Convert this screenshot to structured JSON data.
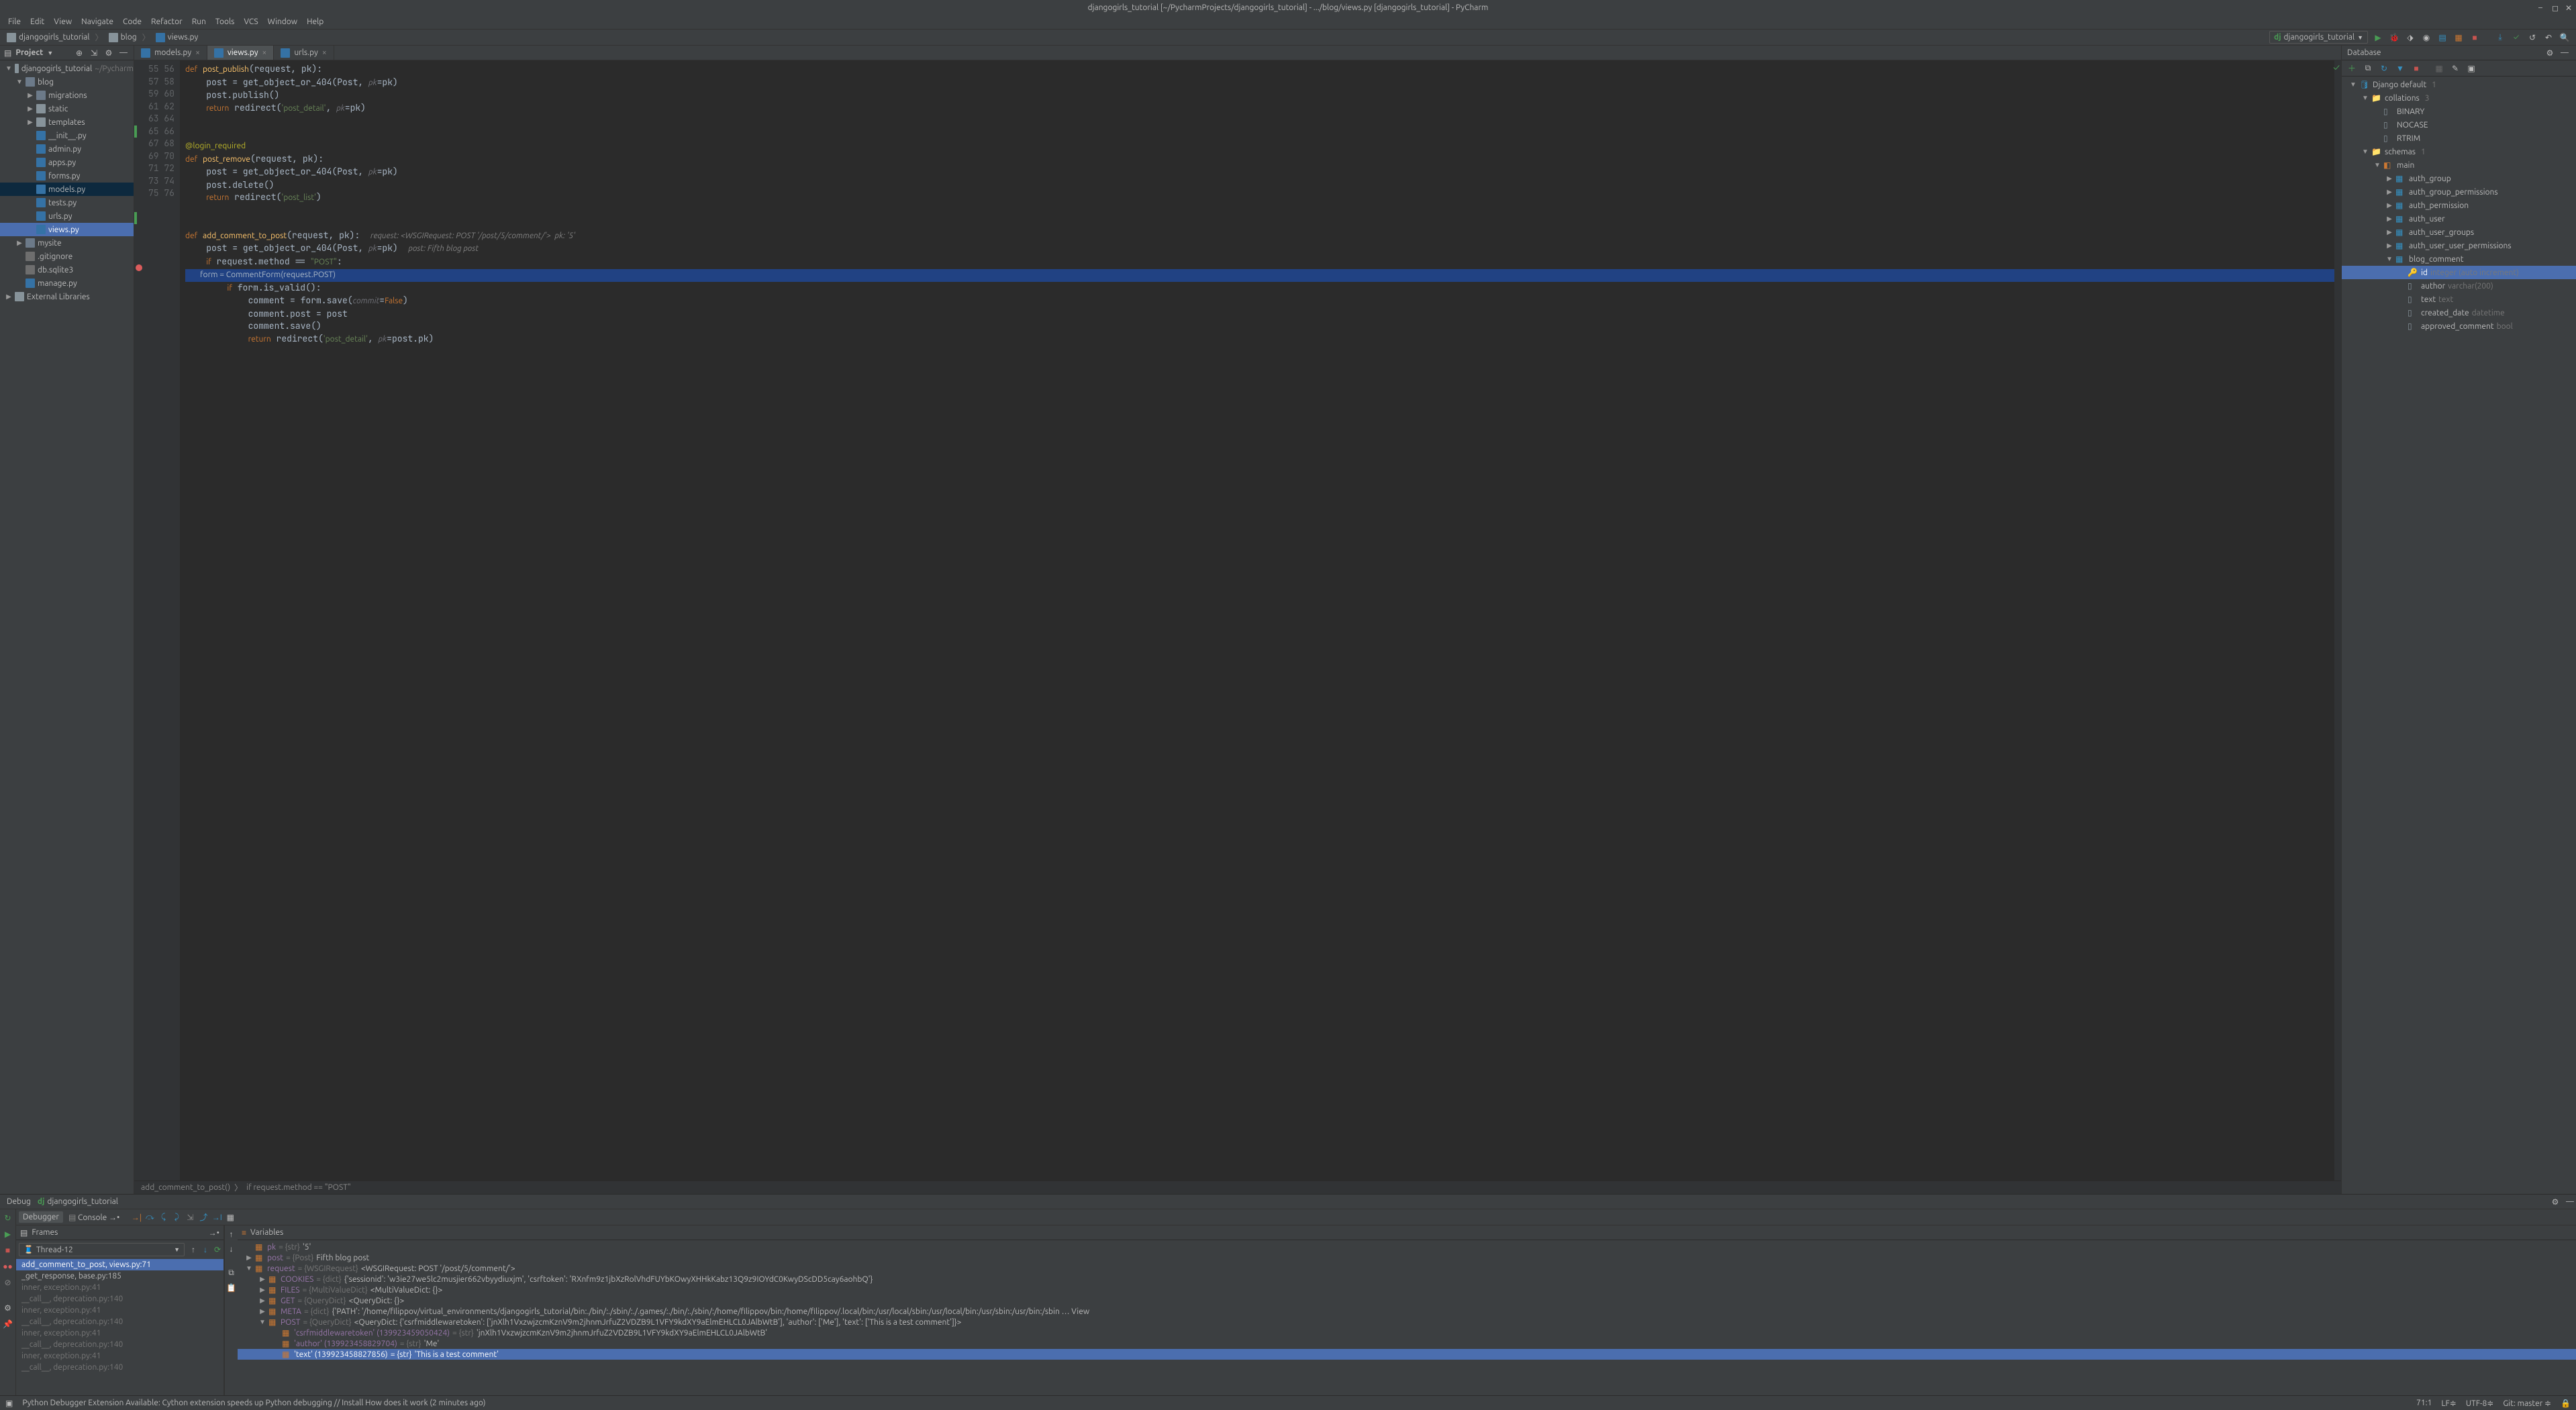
{
  "title": "djangogirls_tutorial [~/PycharmProjects/djangogirls_tutorial] - .../blog/views.py [djangogirls_tutorial] - PyCharm",
  "menu": [
    "File",
    "Edit",
    "View",
    "Navigate",
    "Code",
    "Refactor",
    "Run",
    "Tools",
    "VCS",
    "Window",
    "Help"
  ],
  "nav": {
    "crumbs": [
      {
        "icon": "folder",
        "label": "djangogirls_tutorial"
      },
      {
        "icon": "folder",
        "label": "blog"
      },
      {
        "icon": "py",
        "label": "views.py"
      }
    ],
    "run_config": "djangogirls_tutorial"
  },
  "project": {
    "title": "Project",
    "tree": [
      {
        "d": 0,
        "a": "▼",
        "i": "folder",
        "t": "djangogirls_tutorial",
        "hint": "~/Pycharm"
      },
      {
        "d": 1,
        "a": "▼",
        "i": "pkg",
        "t": "blog"
      },
      {
        "d": 2,
        "a": "▶",
        "i": "pkg",
        "t": "migrations"
      },
      {
        "d": 2,
        "a": "▶",
        "i": "folder",
        "t": "static"
      },
      {
        "d": 2,
        "a": "▶",
        "i": "folder",
        "t": "templates"
      },
      {
        "d": 2,
        "a": "",
        "i": "py",
        "t": "__init__.py"
      },
      {
        "d": 2,
        "a": "",
        "i": "py",
        "t": "admin.py"
      },
      {
        "d": 2,
        "a": "",
        "i": "py",
        "t": "apps.py"
      },
      {
        "d": 2,
        "a": "",
        "i": "py",
        "t": "forms.py"
      },
      {
        "d": 2,
        "a": "",
        "i": "py",
        "t": "models.py",
        "sel": true
      },
      {
        "d": 2,
        "a": "",
        "i": "py",
        "t": "tests.py"
      },
      {
        "d": 2,
        "a": "",
        "i": "py",
        "t": "urls.py"
      },
      {
        "d": 2,
        "a": "",
        "i": "py",
        "t": "views.py",
        "focus": true
      },
      {
        "d": 1,
        "a": "▶",
        "i": "pkg",
        "t": "mysite"
      },
      {
        "d": 1,
        "a": "",
        "i": "file",
        "t": ".gitignore"
      },
      {
        "d": 1,
        "a": "",
        "i": "file",
        "t": "db.sqlite3"
      },
      {
        "d": 1,
        "a": "",
        "i": "py",
        "t": "manage.py"
      },
      {
        "d": 0,
        "a": "▶",
        "i": "folder",
        "t": "External Libraries"
      }
    ]
  },
  "tabs": [
    {
      "label": "models.py",
      "active": false
    },
    {
      "label": "views.py",
      "active": true
    },
    {
      "label": "urls.py",
      "active": false
    }
  ],
  "editor": {
    "first_line": 55,
    "breakpoint_line": 71,
    "mod_lines": [
      60,
      67
    ],
    "crumbs": [
      "add_comment_to_post()",
      "if request.method == \"POST\""
    ]
  },
  "database": {
    "title": "Database",
    "tree": [
      {
        "d": 0,
        "a": "▼",
        "i": "ds",
        "t": "Django default",
        "c": "1"
      },
      {
        "d": 1,
        "a": "▼",
        "i": "folder",
        "t": "collations",
        "c": "3"
      },
      {
        "d": 2,
        "a": "",
        "i": "col",
        "t": "BINARY"
      },
      {
        "d": 2,
        "a": "",
        "i": "col",
        "t": "NOCASE"
      },
      {
        "d": 2,
        "a": "",
        "i": "col",
        "t": "RTRIM"
      },
      {
        "d": 1,
        "a": "▼",
        "i": "folder",
        "t": "schemas",
        "c": "1"
      },
      {
        "d": 2,
        "a": "▼",
        "i": "schema",
        "t": "main"
      },
      {
        "d": 3,
        "a": "▶",
        "i": "table",
        "t": "auth_group"
      },
      {
        "d": 3,
        "a": "▶",
        "i": "table",
        "t": "auth_group_permissions"
      },
      {
        "d": 3,
        "a": "▶",
        "i": "table",
        "t": "auth_permission"
      },
      {
        "d": 3,
        "a": "▶",
        "i": "table",
        "t": "auth_user"
      },
      {
        "d": 3,
        "a": "▶",
        "i": "table",
        "t": "auth_user_groups"
      },
      {
        "d": 3,
        "a": "▶",
        "i": "table",
        "t": "auth_user_user_permissions"
      },
      {
        "d": 3,
        "a": "▼",
        "i": "table",
        "t": "blog_comment"
      },
      {
        "d": 4,
        "a": "",
        "i": "key",
        "t": "id",
        "ty": "integer (auto increment)",
        "hl": true
      },
      {
        "d": 4,
        "a": "",
        "i": "col",
        "t": "author",
        "ty": "varchar(200)"
      },
      {
        "d": 4,
        "a": "",
        "i": "col",
        "t": "text",
        "ty": "text"
      },
      {
        "d": 4,
        "a": "",
        "i": "col",
        "t": "created_date",
        "ty": "datetime"
      },
      {
        "d": 4,
        "a": "",
        "i": "col",
        "t": "approved_comment",
        "ty": "bool"
      }
    ]
  },
  "debug": {
    "label": "Debug",
    "config": "djangogirls_tutorial",
    "tabs": [
      "Debugger",
      "Console"
    ],
    "frames_label": "Frames",
    "variables_label": "Variables",
    "thread": "Thread-12",
    "frames": [
      {
        "t": "add_comment_to_post, views.py:71",
        "sel": true
      },
      {
        "t": "_get_response, base.py:185"
      },
      {
        "t": "inner, exception.py:41",
        "g": true
      },
      {
        "t": "__call__, deprecation.py:140",
        "g": true
      },
      {
        "t": "inner, exception.py:41",
        "g": true
      },
      {
        "t": "__call__, deprecation.py:140",
        "g": true
      },
      {
        "t": "inner, exception.py:41",
        "g": true
      },
      {
        "t": "__call__, deprecation.py:140",
        "g": true
      },
      {
        "t": "inner, exception.py:41",
        "g": true
      },
      {
        "t": "__call__, deprecation.py:140",
        "g": true
      }
    ],
    "vars": [
      {
        "d": 0,
        "a": "",
        "n": "pk",
        "t": "= {str}",
        "v": "'5'"
      },
      {
        "d": 0,
        "a": "▶",
        "n": "post",
        "t": "= {Post}",
        "v": "Fifth blog post"
      },
      {
        "d": 0,
        "a": "▼",
        "n": "request",
        "t": "= {WSGIRequest}",
        "v": "<WSGIRequest: POST '/post/5/comment/'>"
      },
      {
        "d": 1,
        "a": "▶",
        "n": "COOKIES",
        "t": "= {dict}",
        "v": "{'sessionid': 'w3ie27we5lc2musjier662vbyydiuxjm', 'csrftoken': 'RXnfm9z1jbXzRolVhdFUYbKOwyXHHkKabz13Q9z9IOYdC0KwyDScDD5cay6aohbQ'}"
      },
      {
        "d": 1,
        "a": "▶",
        "n": "FILES",
        "t": "= {MultiValueDict}",
        "v": "<MultiValueDict: {}>"
      },
      {
        "d": 1,
        "a": "▶",
        "n": "GET",
        "t": "= {QueryDict}",
        "v": "<QueryDict: {}>"
      },
      {
        "d": 1,
        "a": "▶",
        "n": "META",
        "t": "= {dict}",
        "v": "{'PATH': '/home/filippov/virtual_environments/djangogirls_tutorial/bin:./bin/:./sbin/:./.games/:./bin/:./sbin/:/home/filippov/bin:/home/filippov/.local/bin:/usr/local/sbin:/usr/local/bin:/usr/sbin:/usr/bin:/sbin … View"
      },
      {
        "d": 1,
        "a": "▼",
        "n": "POST",
        "t": "= {QueryDict}",
        "v": "<QueryDict: {'csrfmiddlewaretoken': ['jnXlh1VxzwjzcmKznV9m2jhnmJrfuZ2VDZB9L1VFY9kdXY9aElmEHLCL0JAlbWtB'], 'author': ['Me'], 'text': ['This is a test comment']}>"
      },
      {
        "d": 2,
        "a": "",
        "n": "'csrfmiddlewaretoken' (139923459050424)",
        "t": "= {str}",
        "v": "'jnXlh1VxzwjzcmKznV9m2jhnmJrfuZ2VDZB9L1VFY9kdXY9aElmEHLCL0JAlbWtB'"
      },
      {
        "d": 2,
        "a": "",
        "n": "'author' (139923458829704)",
        "t": "= {str}",
        "v": "'Me'"
      },
      {
        "d": 2,
        "a": "",
        "n": "'text' (139923458827856)",
        "t": "= {str}",
        "v": "'This is a test comment'",
        "sel": true
      }
    ]
  },
  "status": {
    "msg": "Python Debugger Extension Available: Cython extension speeds up Python debugging // Install How does it work (2 minutes ago)",
    "pos": "71:1",
    "lf": "LF≑",
    "enc": "UTF-8≑",
    "git": "Git: master ≑"
  }
}
